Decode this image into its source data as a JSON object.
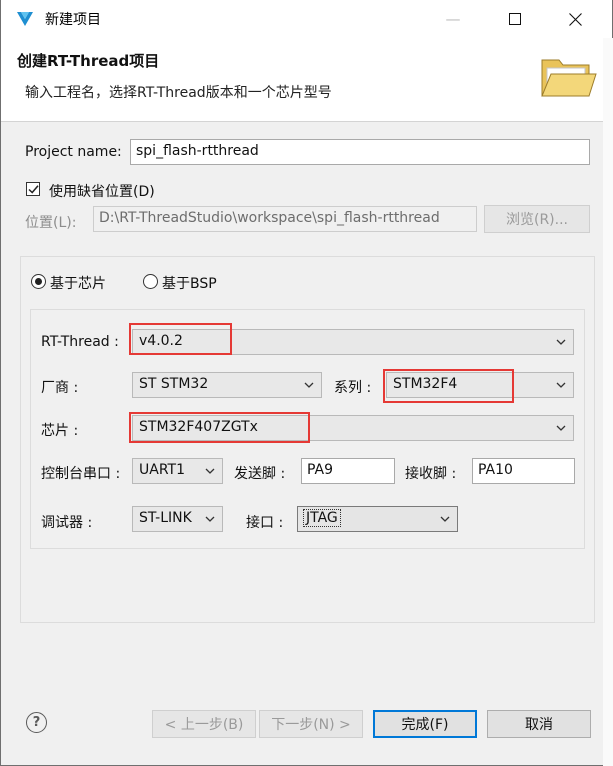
{
  "window": {
    "title": "新建项目",
    "minimize_glyph": "—",
    "maximize_glyph": "☐",
    "close_glyph": "✕"
  },
  "header": {
    "title": "创建RT-Thread项目",
    "description": "输入工程名，选择RT-Thread版本和一个芯片型号"
  },
  "form": {
    "project_name_label": "Project name:",
    "project_name_value": "spi_flash-rtthread",
    "use_default_location_label": "使用缺省位置(D)",
    "use_default_location_checked": true,
    "location_label": "位置(L):",
    "location_value": "D:\\RT-ThreadStudio\\workspace\\spi_flash-rtthread",
    "browse_button": "浏览(R)..."
  },
  "base": {
    "option_chip": "基于芯片",
    "option_bsp": "基于BSP",
    "selected": "基于芯片"
  },
  "chip_settings": {
    "rtthread_label": "RT-Thread :",
    "rtthread_value": "v4.0.2",
    "vendor_label": "厂商 :",
    "vendor_value": "ST STM32",
    "series_label": "系列 :",
    "series_value": "STM32F4",
    "chip_label": "芯片 :",
    "chip_value": "STM32F407ZGTx",
    "console_label": "控制台串口 :",
    "console_value": "UART1",
    "tx_label": "发送脚 :",
    "tx_value": "PA9",
    "rx_label": "接收脚 :",
    "rx_value": "PA10",
    "debugger_label": "调试器 :",
    "debugger_value": "ST-LINK",
    "interface_label": "接口 :",
    "interface_value": "JTAG"
  },
  "footer": {
    "help_glyph": "?",
    "back_button": "< 上一步(B)",
    "next_button": "下一步(N) >",
    "finish_button": "完成(F)",
    "cancel_button": "取消"
  },
  "colors": {
    "highlight_box": "#e53935",
    "focus_border": "#0078d7"
  }
}
